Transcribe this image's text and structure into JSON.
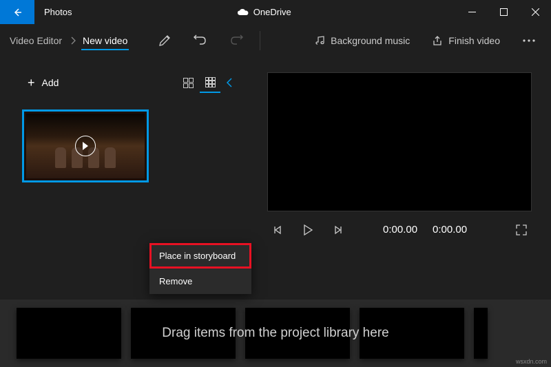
{
  "titlebar": {
    "app_name": "Photos",
    "cloud_label": "OneDrive"
  },
  "breadcrumb": {
    "root": "Video Editor",
    "current": "New video"
  },
  "toolbar": {
    "bg_music": "Background music",
    "finish": "Finish video"
  },
  "library": {
    "add_label": "Add"
  },
  "context_menu": {
    "place": "Place in storyboard",
    "remove": "Remove"
  },
  "player": {
    "time_current": "0:00.00",
    "time_total": "0:00.00"
  },
  "storyboard": {
    "hint": "Drag items from the project library here"
  },
  "watermark": "wsxdn.com"
}
